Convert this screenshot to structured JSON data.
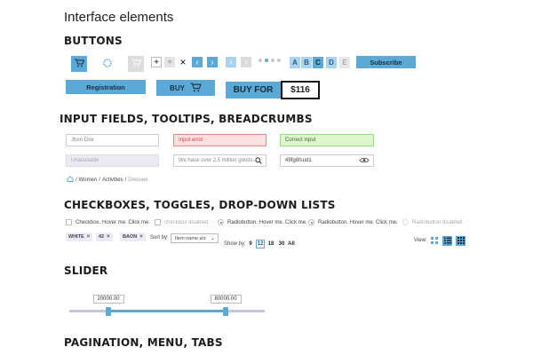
{
  "page": {
    "title": "Interface elements"
  },
  "sections": {
    "buttons": "BUTTONS",
    "inputs": "INPUT FIELDS, TOOLTIPS, BREADCRUMBS",
    "checkboxes": "CHECKBOXES, TOGGLES, DROP-DOWN LISTS",
    "slider": "SLIDER",
    "pagination": "PAGINATION, MENU, TABS"
  },
  "buttons": {
    "controls": {
      "plus": "+",
      "close": "×",
      "prev": "‹",
      "next": "›"
    },
    "letters": [
      "A",
      "B",
      "C",
      "D",
      "E"
    ],
    "subscribe": "Subscribe",
    "registration": "Registration",
    "buy": "BUY",
    "buy_for": "BUY FOR",
    "price": "$116"
  },
  "inputs": {
    "name": "Jhon Doe",
    "error": "Input error",
    "correct": "Correct input",
    "unavailable": "Unavailable",
    "search_placeholder": "We have over 2.5 million goods...",
    "password": "49fg8fsud1"
  },
  "breadcrumbs": {
    "sep": "/",
    "women": "Women",
    "activities": "Activities",
    "dresses": "Dresses"
  },
  "checks": {
    "checkbox": "Checkbox. Hover me. Click me.",
    "checkbox_disabled": "checkbox disabled",
    "radio1": "Radiobutton. Hover me. Click me.",
    "radio2": "Radiobutton. Hover me. Click me.",
    "radio_disabled": "Radiobutton disabled."
  },
  "filters": {
    "tags": [
      "WHITE",
      "42",
      "BAON"
    ],
    "tag_close": "×",
    "sort_label": "Sort by:",
    "sort_value": "Item name a/z",
    "show_label": "Show by:",
    "show_options": [
      "9",
      "12",
      "18",
      "30",
      "All"
    ],
    "show_selected": "12",
    "view_label": "View:"
  },
  "slider": {
    "min": 20000,
    "max": 80000,
    "low_label": "20000.00",
    "high_label": "80000.00",
    "low_fraction": 0.2,
    "high_fraction": 0.8
  },
  "colors": {
    "accent": "#5aa9d6",
    "error_bg": "#fde0e0",
    "ok_bg": "#def7c8"
  }
}
